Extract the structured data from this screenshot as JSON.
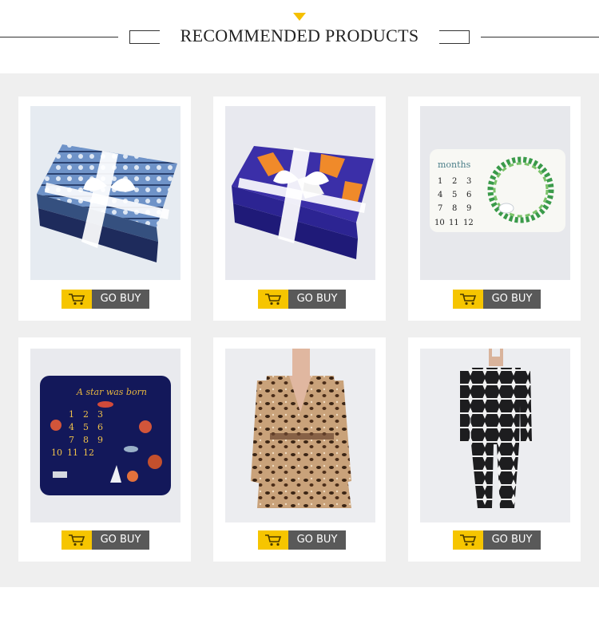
{
  "header": {
    "title": "RECOMMENDED PRODUCTS",
    "accent_color": "#f5c000"
  },
  "products": [
    {
      "image": "blue-fair-isle-fleece-blanket-with-ribbon",
      "button_label": "GO BUY"
    },
    {
      "image": "purple-aztec-fleece-blanket-with-ribbon",
      "button_label": "GO BUY"
    },
    {
      "image": "baby-milestone-months-blanket-wreath",
      "button_label": "GO BUY"
    },
    {
      "image": "a-star-was-born-space-milestone-blanket",
      "button_label": "GO BUY",
      "blanket_text": "A star was born",
      "numbers": [
        "1",
        "2",
        "3",
        "4",
        "5",
        "6",
        "7",
        "8",
        "9",
        "10",
        "11",
        "12"
      ]
    },
    {
      "image": "leopard-print-hooded-robe",
      "button_label": "GO BUY"
    },
    {
      "image": "nordic-pattern-onesie-pajama",
      "button_label": "GO BUY"
    }
  ],
  "milestone": {
    "title": "months",
    "numbers": [
      "1",
      "2",
      "3",
      "4",
      "5",
      "6",
      "7",
      "8",
      "9",
      "10",
      "11",
      "12"
    ]
  },
  "icons": {
    "cart": "shopping-cart-icon"
  },
  "colors": {
    "button_dark": "#595959",
    "button_accent": "#f6c500",
    "section_bg": "#efefef"
  }
}
